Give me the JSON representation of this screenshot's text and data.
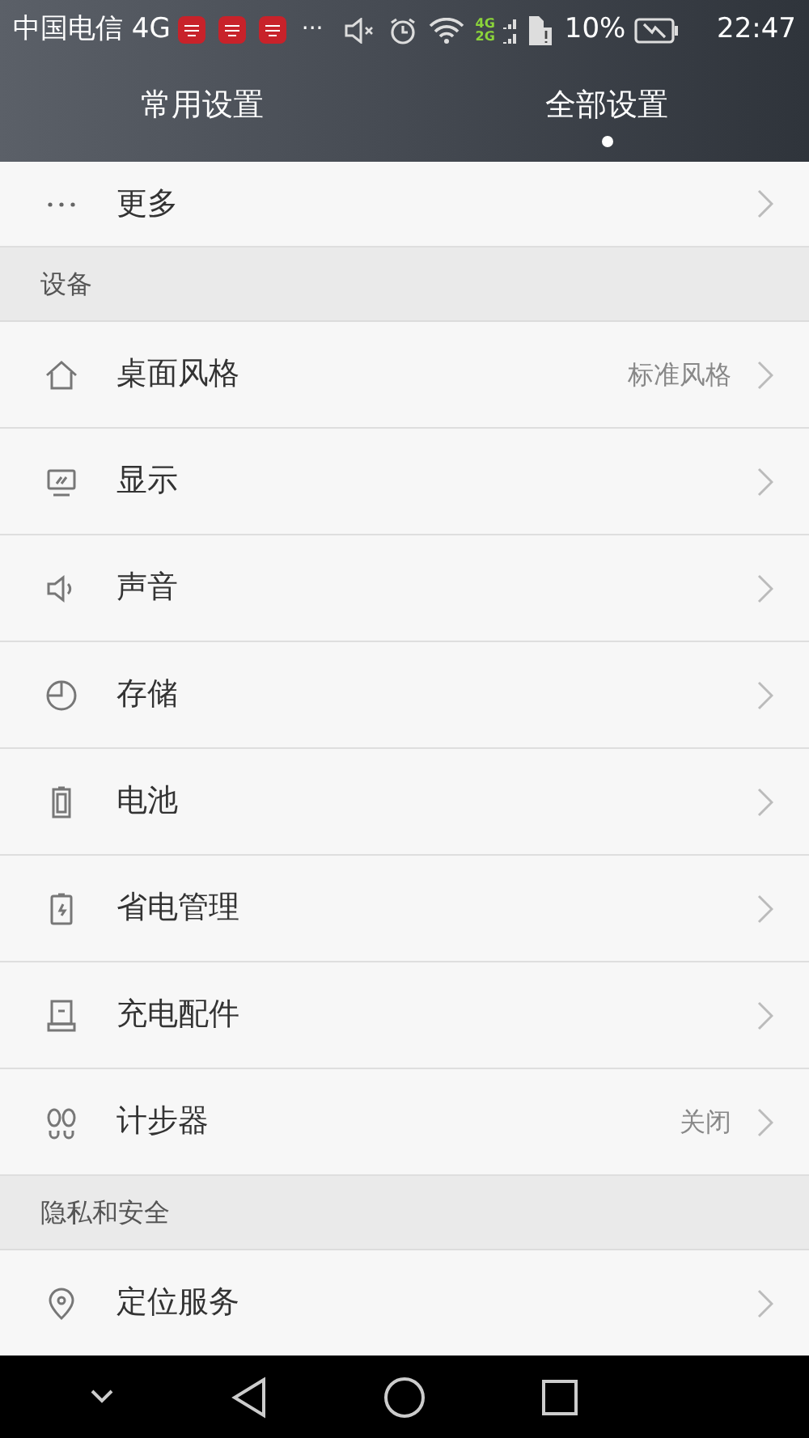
{
  "status_bar": {
    "carrier": "中国电信 4G",
    "ellipsis": "···",
    "network_4g": "4G",
    "network_2g": "2G",
    "battery": "10%",
    "time": "22:47"
  },
  "tabs": [
    {
      "label": "常用设置",
      "selected": false
    },
    {
      "label": "全部设置",
      "selected": true
    }
  ],
  "list": [
    {
      "kind": "row",
      "label": "更多"
    },
    {
      "kind": "header",
      "label": "设备"
    },
    {
      "kind": "row",
      "label": "桌面风格",
      "value": "标准风格"
    },
    {
      "kind": "row",
      "label": "显示"
    },
    {
      "kind": "row",
      "label": "声音"
    },
    {
      "kind": "row",
      "label": "存储"
    },
    {
      "kind": "row",
      "label": "电池"
    },
    {
      "kind": "row",
      "label": "省电管理"
    },
    {
      "kind": "row",
      "label": "充电配件"
    },
    {
      "kind": "row",
      "label": "计步器",
      "value": "关闭"
    },
    {
      "kind": "header",
      "label": "隐私和安全"
    },
    {
      "kind": "row",
      "label": "定位服务"
    }
  ]
}
